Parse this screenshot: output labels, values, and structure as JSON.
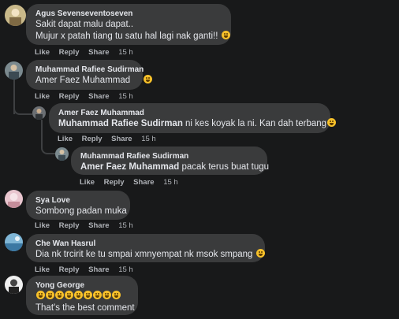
{
  "comments": [
    {
      "author": "Agus Sevenseventoseven",
      "lines": [
        "Sakit dapat malu dapat..",
        "Mujur x patah tiang tu satu hal lagi nak ganti!!"
      ],
      "actions": {
        "like": "Like",
        "reply": "Reply",
        "share": "Share",
        "time": "15 h"
      }
    },
    {
      "author": "Muhammad Rafiee Sudirman",
      "text": "Amer Faez Muhammad",
      "actions": {
        "like": "Like",
        "reply": "Reply",
        "share": "Share",
        "time": "15 h"
      }
    },
    {
      "author": "Amer Faez Muhammad",
      "tag": "Muhammad Rafiee Sudirman",
      "text": " ni kes koyak la ni. Kan dah terbang",
      "actions": {
        "like": "Like",
        "reply": "Reply",
        "share": "Share",
        "time": "15 h"
      }
    },
    {
      "author": "Muhammad Rafiee Sudirman",
      "tag": "Amer Faez Muhammad",
      "text": " pacak terus buat tugu",
      "actions": {
        "like": "Like",
        "reply": "Reply",
        "share": "Share",
        "time": "15 h"
      }
    },
    {
      "author": "Sya Love",
      "text": "Sombong padan muka",
      "actions": {
        "like": "Like",
        "reply": "Reply",
        "share": "Share",
        "time": "15 h"
      }
    },
    {
      "author": "Che Wan Hasrul",
      "text": "Dia nk trcirit ke tu smpai xmnyempat nk msok smpang",
      "actions": {
        "like": "Like",
        "reply": "Reply",
        "share": "Share",
        "time": "15 h"
      }
    },
    {
      "author": "Yong George",
      "text": "That's the best comment"
    }
  ],
  "colors": {
    "background": "#18191a",
    "bubble": "#3a3b3c",
    "text": "#e4e6eb",
    "secondary": "#b0b3b8"
  },
  "icons": [
    "laughing-emoji-icon",
    "grinning-squint-emoji-icon",
    "rolling-laughing-emoji-icon"
  ]
}
